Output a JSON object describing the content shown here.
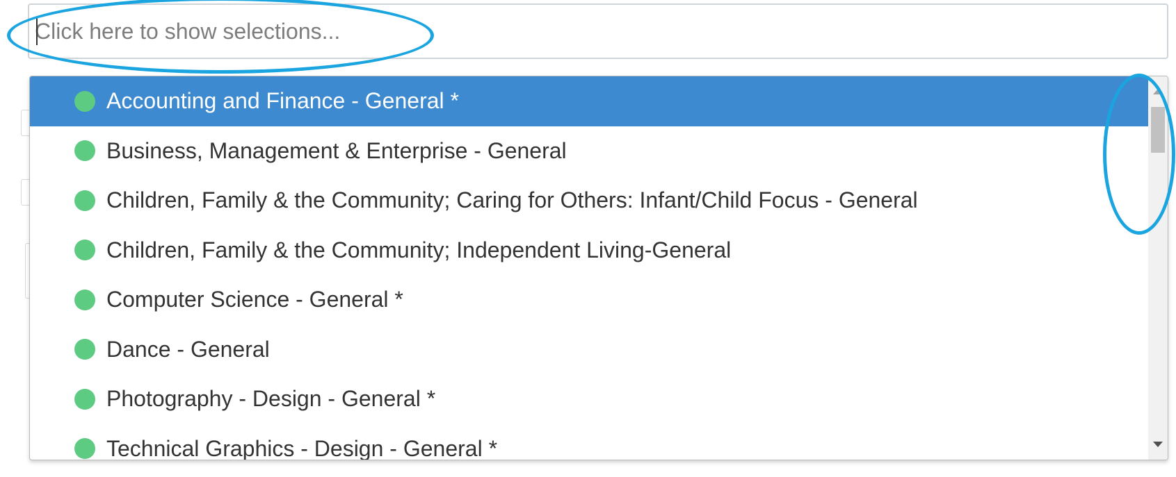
{
  "search": {
    "placeholder": "Click here to show selections..."
  },
  "options": [
    {
      "label": "Accounting and Finance - General *",
      "selected": true
    },
    {
      "label": "Business, Management & Enterprise - General",
      "selected": false
    },
    {
      "label": "Children, Family & the Community; Caring for Others: Infant/Child Focus - General",
      "selected": false
    },
    {
      "label": "Children, Family & the Community; Independent Living-General",
      "selected": false
    },
    {
      "label": "Computer Science - General *",
      "selected": false
    },
    {
      "label": "Dance - General",
      "selected": false
    },
    {
      "label": "Photography - Design - General *",
      "selected": false
    },
    {
      "label": "Technical Graphics - Design - General *",
      "selected": false
    }
  ],
  "colors": {
    "selected_bg": "#3d8ad0",
    "dot": "#5ecb82",
    "annotation": "#1aa5e0"
  }
}
